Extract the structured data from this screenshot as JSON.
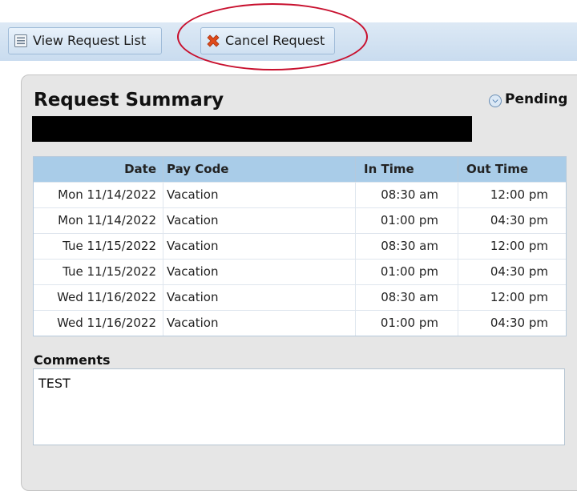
{
  "toolbar": {
    "view_label": "View Request List",
    "cancel_label": "Cancel Request"
  },
  "request": {
    "title": "Request Summary",
    "status": "Pending"
  },
  "table": {
    "headers": [
      "Date",
      "Pay Code",
      "In Time",
      "Out Time"
    ],
    "rows": [
      [
        "Mon 11/14/2022",
        "Vacation",
        "08:30 am",
        "12:00 pm"
      ],
      [
        "Mon 11/14/2022",
        "Vacation",
        "01:00 pm",
        "04:30 pm"
      ],
      [
        "Tue 11/15/2022",
        "Vacation",
        "08:30 am",
        "12:00 pm"
      ],
      [
        "Tue 11/15/2022",
        "Vacation",
        "01:00 pm",
        "04:30 pm"
      ],
      [
        "Wed 11/16/2022",
        "Vacation",
        "08:30 am",
        "12:00 pm"
      ],
      [
        "Wed 11/16/2022",
        "Vacation",
        "01:00 pm",
        "04:30 pm"
      ]
    ]
  },
  "comments": {
    "label": "Comments",
    "value": "TEST"
  },
  "icons": {
    "view": "list-icon",
    "cancel": "cancel-x-icon",
    "status": "status-chevron-icon"
  },
  "colors": {
    "toolbar": "#c9dcef",
    "table_header": "#a9cce8",
    "panel": "#e6e6e6",
    "annotation": "#c8102e",
    "cancel_icon": "#e04a1a"
  }
}
